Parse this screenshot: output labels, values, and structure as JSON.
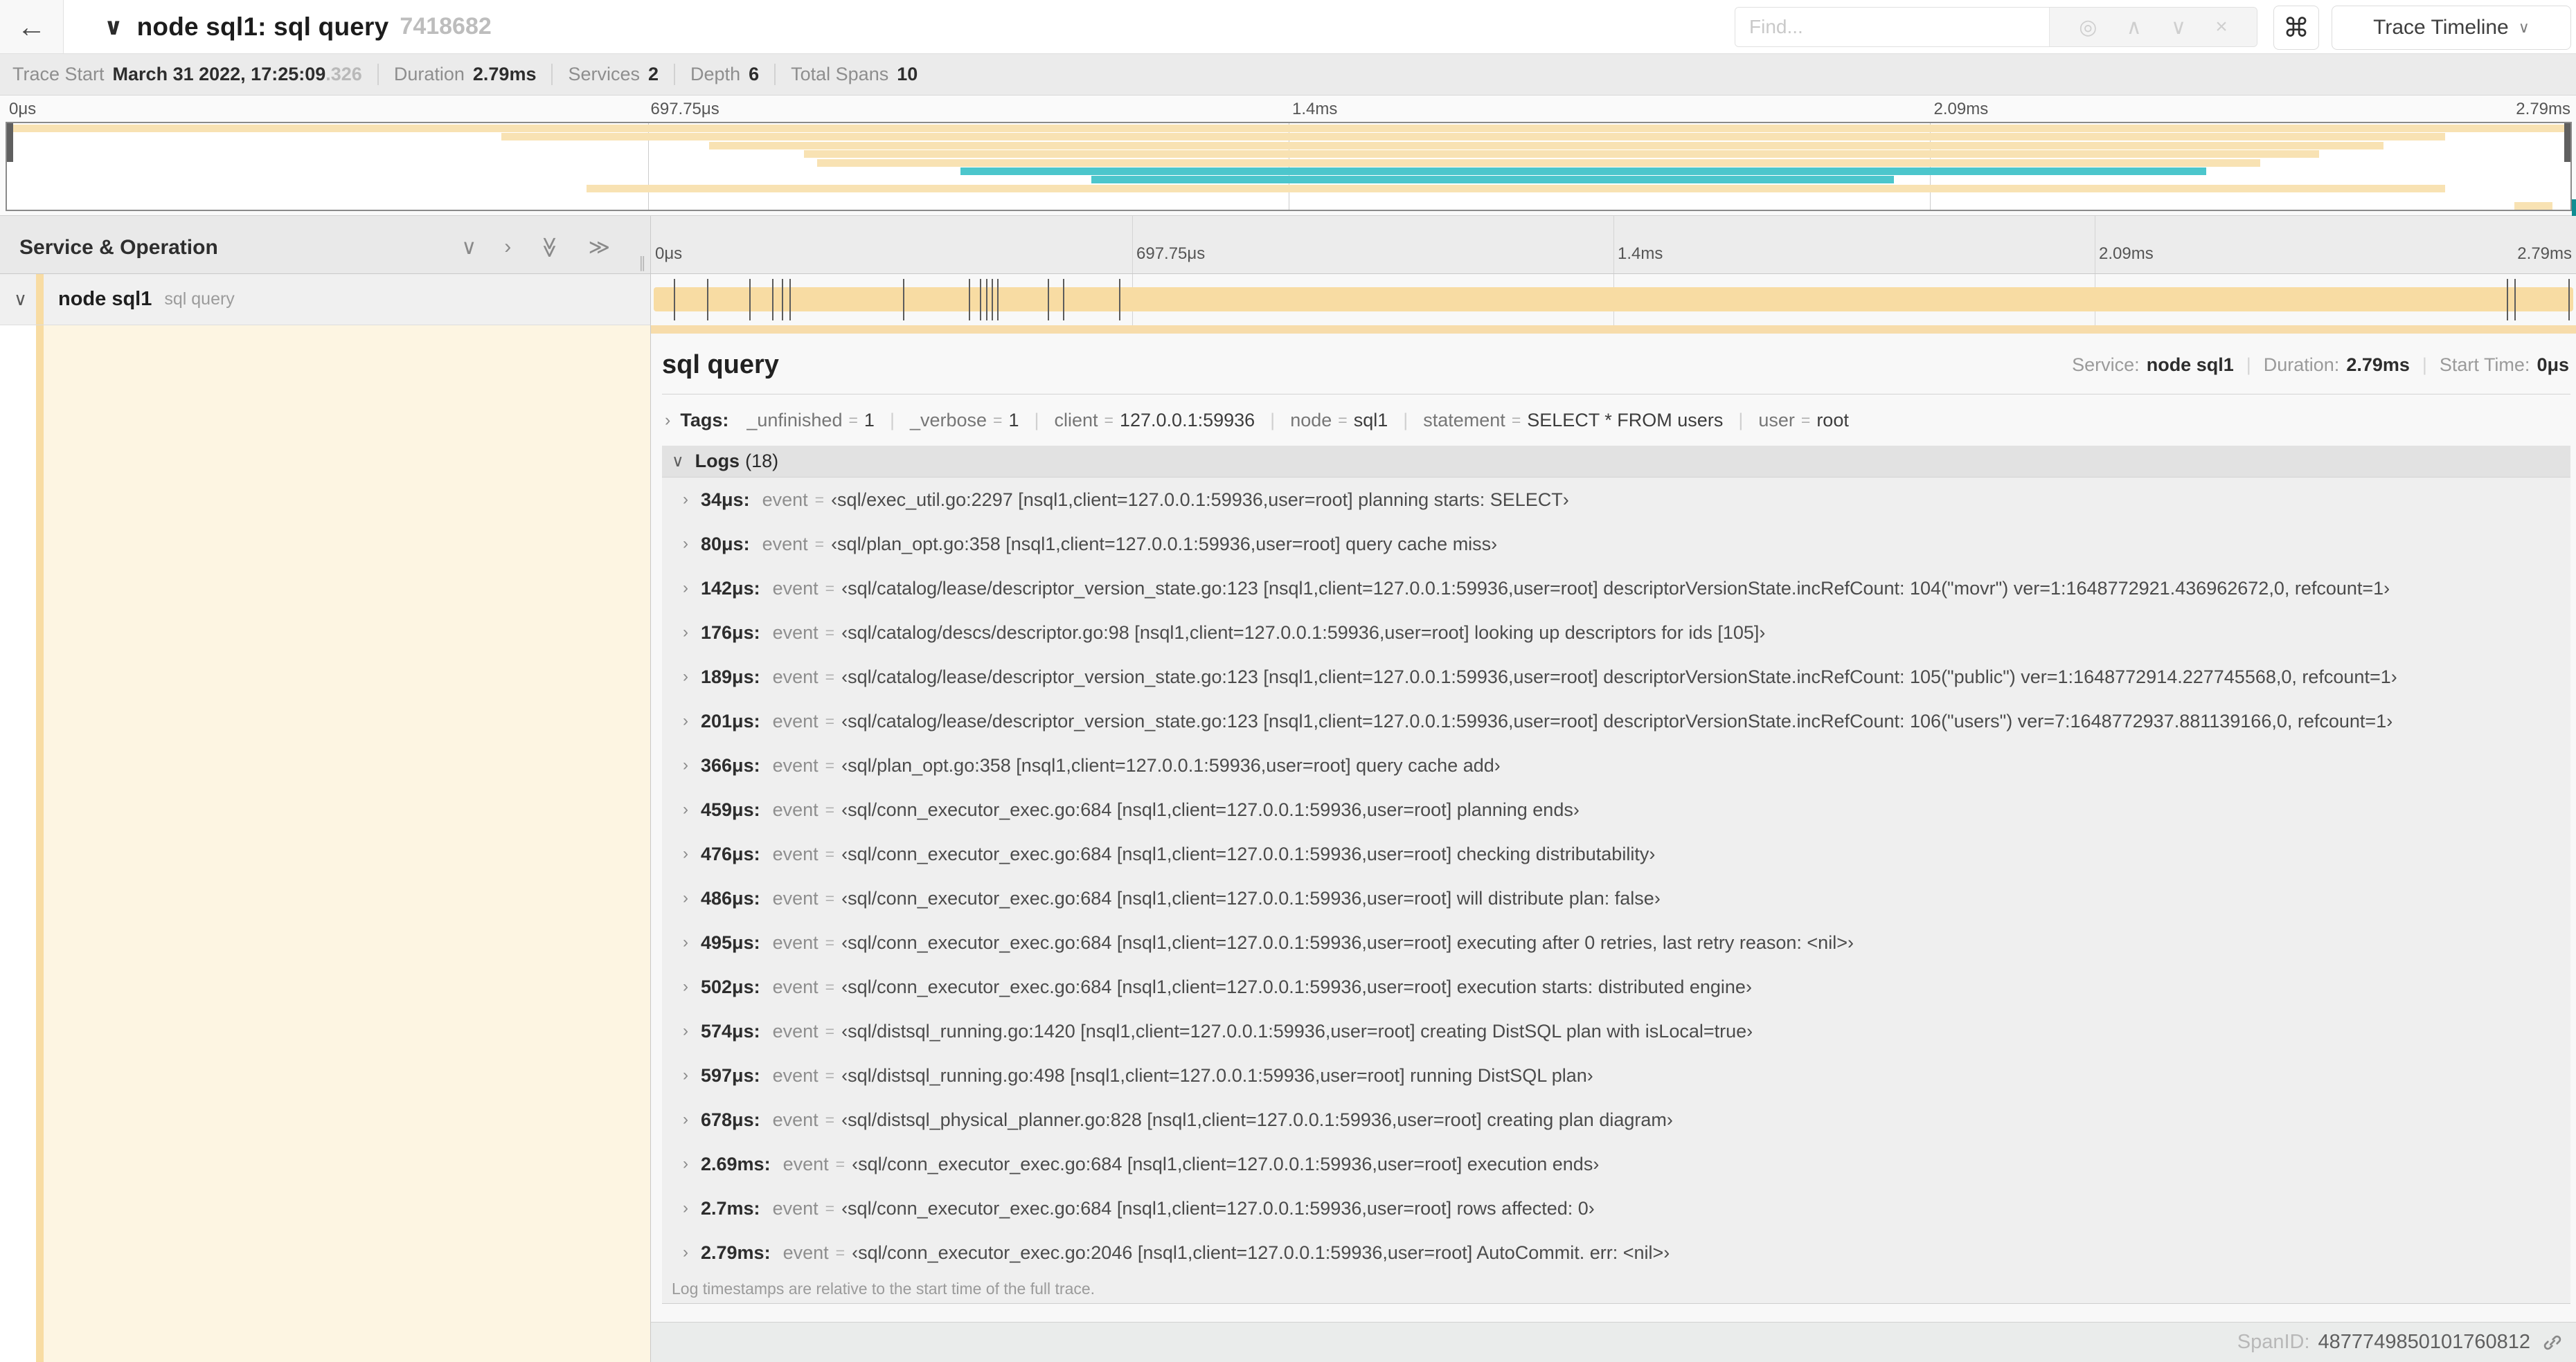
{
  "header": {
    "back_icon": "←",
    "collapse_icon": "∨",
    "title": "node sql1: sql query",
    "trace_id": "7418682",
    "find_placeholder": "Find...",
    "icons": {
      "locate": "◎",
      "prev": "∧",
      "next": "∨",
      "clear": "×"
    },
    "shortcut_icon": "⌘",
    "view_selector": "Trace Timeline",
    "caret_icon": "∨"
  },
  "summary": {
    "items": [
      {
        "label": "Trace Start",
        "value": "March 31 2022, 17:25:09",
        "suffix": ".326"
      },
      {
        "label": "Duration",
        "value": "2.79ms",
        "suffix": ""
      },
      {
        "label": "Services",
        "value": "2",
        "suffix": ""
      },
      {
        "label": "Depth",
        "value": "6",
        "suffix": ""
      },
      {
        "label": "Total Spans",
        "value": "10",
        "suffix": ""
      }
    ]
  },
  "timeline": {
    "ticks": [
      "0μs",
      "697.75μs",
      "1.4ms",
      "2.09ms",
      "2.79ms"
    ],
    "tick_positions": [
      0,
      25,
      50,
      75,
      100
    ],
    "grid_fractions": [
      25,
      50,
      75
    ],
    "colors": {
      "amber": "#f8e2b3",
      "teal": "#4cc6cc",
      "bar_amber": "#f8dca3"
    },
    "minimap_spans": [
      {
        "row": 0,
        "start": 0,
        "end": 100,
        "color": "amber"
      },
      {
        "row": 1,
        "start": 19.3,
        "end": 95.1,
        "color": "amber"
      },
      {
        "row": 2,
        "start": 27.4,
        "end": 92.7,
        "color": "amber"
      },
      {
        "row": 3,
        "start": 31.1,
        "end": 90.2,
        "color": "amber"
      },
      {
        "row": 4,
        "start": 31.6,
        "end": 87.9,
        "color": "amber"
      },
      {
        "row": 5,
        "start": 37.2,
        "end": 85.8,
        "color": "teal"
      },
      {
        "row": 6,
        "start": 42.3,
        "end": 73.6,
        "color": "teal"
      },
      {
        "row": 7,
        "start": 22.6,
        "end": 95.1,
        "color": "amber"
      },
      {
        "row": 9,
        "start": 97.8,
        "end": 99.3,
        "color": "amber"
      }
    ]
  },
  "span_table": {
    "header": "Service & Operation",
    "collapse_one_icon": "∨",
    "expand_one_icon": "›",
    "collapse_all_icon": "≫",
    "expand_all_icon": "≫",
    "grip_icon": "∥",
    "row": {
      "chevron": "∨",
      "service": "node sql1",
      "operation": "sql query"
    },
    "log_marker_fractions": [
      1.2,
      2.9,
      5.1,
      6.3,
      6.8,
      7.2,
      13.1,
      16.5,
      17.1,
      17.4,
      17.7,
      18.0,
      20.6,
      21.4,
      24.3,
      96.4,
      96.8,
      99.6
    ]
  },
  "detail": {
    "operation": "sql query",
    "overview": [
      {
        "label": "Service:",
        "value": "node sql1"
      },
      {
        "label": "Duration:",
        "value": "2.79ms"
      },
      {
        "label": "Start Time:",
        "value": "0μs"
      }
    ],
    "tags_chevron": "›",
    "tags_label": "Tags:",
    "tags": [
      {
        "key": "_unfinished",
        "value": "1"
      },
      {
        "key": "_verbose",
        "value": "1"
      },
      {
        "key": "client",
        "value": "127.0.0.1:59936"
      },
      {
        "key": "node",
        "value": "sql1"
      },
      {
        "key": "statement",
        "value": "SELECT * FROM users"
      },
      {
        "key": "user",
        "value": "root"
      }
    ],
    "logs_chevron": "∨",
    "logs_label": "Logs",
    "logs_count": "(18)",
    "log_row_chevron": "›",
    "event_key": "event",
    "eq_sign": "=",
    "logs": [
      {
        "time": "34μs:",
        "value": "‹sql/exec_util.go:2297 [nsql1,client=127.0.0.1:59936,user=root] planning starts: SELECT›"
      },
      {
        "time": "80μs:",
        "value": "‹sql/plan_opt.go:358 [nsql1,client=127.0.0.1:59936,user=root] query cache miss›"
      },
      {
        "time": "142μs:",
        "value": "‹sql/catalog/lease/descriptor_version_state.go:123 [nsql1,client=127.0.0.1:59936,user=root] descriptorVersionState.incRefCount: 104(\"movr\") ver=1:1648772921.436962672,0, refcount=1›"
      },
      {
        "time": "176μs:",
        "value": "‹sql/catalog/descs/descriptor.go:98 [nsql1,client=127.0.0.1:59936,user=root] looking up descriptors for ids [105]›"
      },
      {
        "time": "189μs:",
        "value": "‹sql/catalog/lease/descriptor_version_state.go:123 [nsql1,client=127.0.0.1:59936,user=root] descriptorVersionState.incRefCount: 105(\"public\") ver=1:1648772914.227745568,0, refcount=1›"
      },
      {
        "time": "201μs:",
        "value": "‹sql/catalog/lease/descriptor_version_state.go:123 [nsql1,client=127.0.0.1:59936,user=root] descriptorVersionState.incRefCount: 106(\"users\") ver=7:1648772937.881139166,0, refcount=1›"
      },
      {
        "time": "366μs:",
        "value": "‹sql/plan_opt.go:358 [nsql1,client=127.0.0.1:59936,user=root] query cache add›"
      },
      {
        "time": "459μs:",
        "value": "‹sql/conn_executor_exec.go:684 [nsql1,client=127.0.0.1:59936,user=root] planning ends›"
      },
      {
        "time": "476μs:",
        "value": "‹sql/conn_executor_exec.go:684 [nsql1,client=127.0.0.1:59936,user=root] checking distributability›"
      },
      {
        "time": "486μs:",
        "value": "‹sql/conn_executor_exec.go:684 [nsql1,client=127.0.0.1:59936,user=root] will distribute plan: false›"
      },
      {
        "time": "495μs:",
        "value": "‹sql/conn_executor_exec.go:684 [nsql1,client=127.0.0.1:59936,user=root] executing after 0 retries, last retry reason: <nil>›"
      },
      {
        "time": "502μs:",
        "value": "‹sql/conn_executor_exec.go:684 [nsql1,client=127.0.0.1:59936,user=root] execution starts: distributed engine›"
      },
      {
        "time": "574μs:",
        "value": "‹sql/distsql_running.go:1420 [nsql1,client=127.0.0.1:59936,user=root] creating DistSQL plan with isLocal=true›"
      },
      {
        "time": "597μs:",
        "value": "‹sql/distsql_running.go:498 [nsql1,client=127.0.0.1:59936,user=root] running DistSQL plan›"
      },
      {
        "time": "678μs:",
        "value": "‹sql/distsql_physical_planner.go:828 [nsql1,client=127.0.0.1:59936,user=root] creating plan diagram›"
      },
      {
        "time": "2.69ms:",
        "value": "‹sql/conn_executor_exec.go:684 [nsql1,client=127.0.0.1:59936,user=root] execution ends›"
      },
      {
        "time": "2.7ms:",
        "value": "‹sql/conn_executor_exec.go:684 [nsql1,client=127.0.0.1:59936,user=root] rows affected: 0›"
      },
      {
        "time": "2.79ms:",
        "value": "‹sql/conn_executor_exec.go:2046 [nsql1,client=127.0.0.1:59936,user=root] AutoCommit. err: <nil>›"
      }
    ],
    "logs_note": "Log timestamps are relative to the start time of the full trace.",
    "spanid_label": "SpanID:",
    "spanid": "4877749850101760812"
  }
}
